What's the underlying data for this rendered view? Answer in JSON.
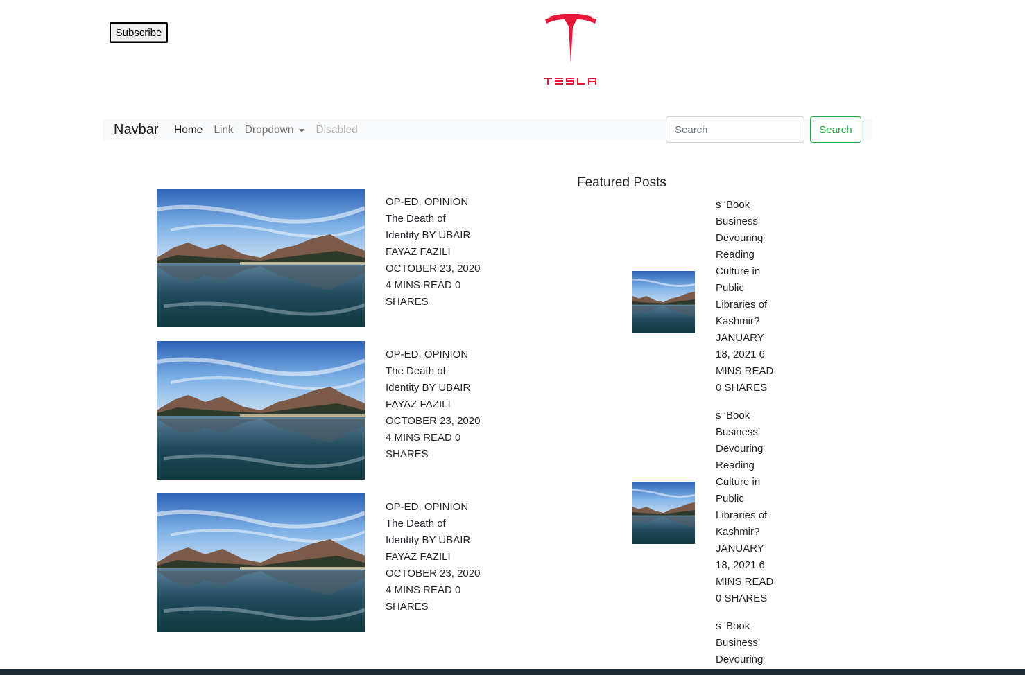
{
  "header": {
    "subscribe_label": "Subscribe",
    "logo_text": "TESLA",
    "brand_color": "#e31937"
  },
  "navbar": {
    "brand": "Navbar",
    "links": [
      {
        "label": "Home",
        "state": "active"
      },
      {
        "label": "Link",
        "state": "normal"
      },
      {
        "label": "Dropdown",
        "state": "dropdown"
      },
      {
        "label": "Disabled",
        "state": "disabled"
      }
    ],
    "search_placeholder": "Search",
    "search_button": "Search",
    "search_button_color": "#28a745"
  },
  "posts": [
    {
      "lines": [
        "OP-ED, OPINION",
        "The Death of",
        "Identity BY UBAIR",
        "FAYAZ FAZILI",
        "OCTOBER 23, 2020",
        "4 MINS READ 0",
        "SHARES"
      ]
    },
    {
      "lines": [
        "OP-ED, OPINION",
        "The Death of",
        "Identity BY UBAIR",
        "FAYAZ FAZILI",
        "OCTOBER 23, 2020",
        "4 MINS READ 0",
        "SHARES"
      ]
    },
    {
      "lines": [
        "OP-ED, OPINION",
        "The Death of",
        "Identity BY UBAIR",
        "FAYAZ FAZILI",
        "OCTOBER 23, 2020",
        "4 MINS READ 0",
        "SHARES"
      ]
    }
  ],
  "featured": {
    "title": "Featured Posts",
    "items": [
      {
        "lines": [
          "s ‘Book",
          "Business’",
          "Devouring",
          "Reading",
          "Culture in",
          "Public",
          "Libraries of",
          "Kashmir?",
          "JANUARY",
          "18, 2021 6",
          "MINS READ",
          "0 SHARES"
        ]
      },
      {
        "lines": [
          "s ‘Book",
          "Business’",
          "Devouring",
          "Reading",
          "Culture in",
          "Public",
          "Libraries of",
          "Kashmir?",
          "JANUARY",
          "18, 2021 6",
          "MINS READ",
          "0 SHARES"
        ]
      },
      {
        "lines": [
          "s ‘Book",
          "Business’",
          "Devouring"
        ]
      }
    ]
  }
}
